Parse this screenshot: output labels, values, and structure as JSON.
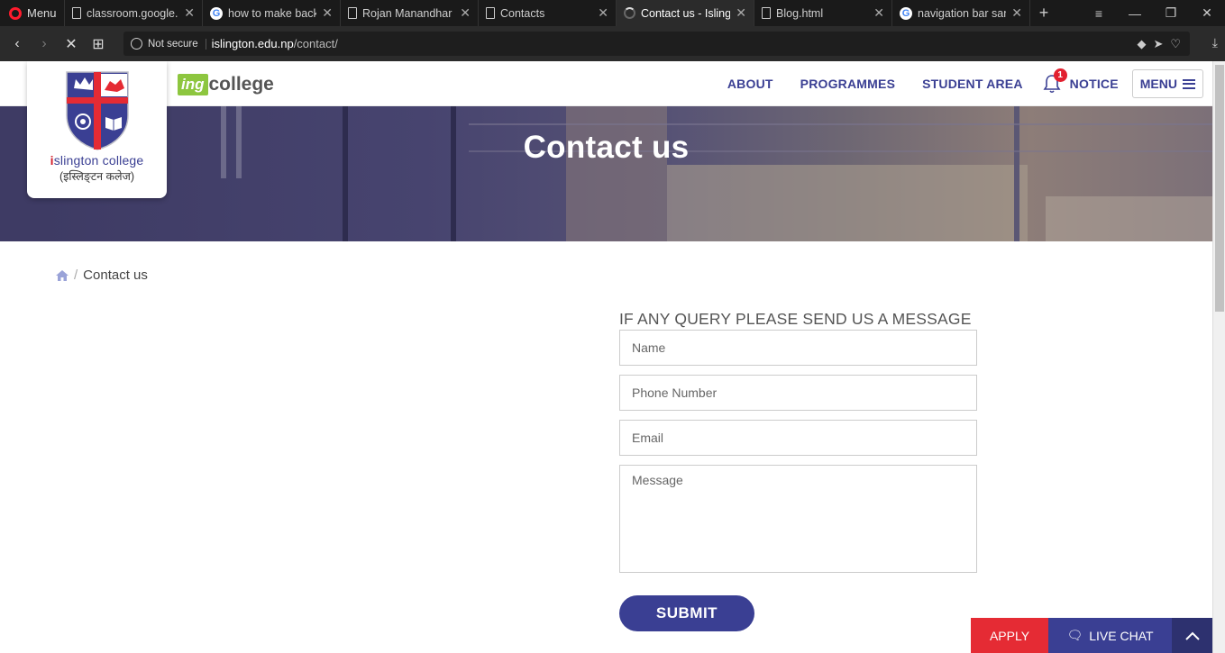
{
  "browser": {
    "menu_label": "Menu",
    "tabs": [
      {
        "title": "classroom.google.",
        "icon": "doc"
      },
      {
        "title": "how to make back",
        "icon": "google"
      },
      {
        "title": "Rojan Manandhar",
        "icon": "doc"
      },
      {
        "title": "Contacts",
        "icon": "doc"
      },
      {
        "title": "Contact us - Isling",
        "icon": "loading",
        "active": true
      },
      {
        "title": "Blog.html",
        "icon": "doc"
      },
      {
        "title": "navigation bar san",
        "icon": "google"
      }
    ],
    "security_label": "Not secure",
    "url_host": "islington.edu.np",
    "url_path": "/contact/"
  },
  "site": {
    "logo_name_i": "i",
    "logo_name_rest": "slington college",
    "logo_sub": "(इस्लिङ्टन कलेज)",
    "ing_label": "ing",
    "ing_college": "college",
    "nav": {
      "about": "ABOUT",
      "programmes": "PROGRAMMES",
      "student_area": "STUDENT AREA",
      "notice": "NOTICE",
      "notice_count": "1",
      "menu": "MENU"
    }
  },
  "hero": {
    "title": "Contact us"
  },
  "breadcrumb": {
    "current": "Contact us"
  },
  "form": {
    "title": "IF ANY QUERY PLEASE SEND US A MESSAGE",
    "name_placeholder": "Name",
    "phone_placeholder": "Phone Number",
    "email_placeholder": "Email",
    "message_placeholder": "Message",
    "submit_label": "SUBMIT"
  },
  "sticky": {
    "apply_label": "APPLY",
    "live_chat_label": "LIVE CHAT"
  },
  "colors": {
    "brand_blue": "#3a3f93",
    "brand_red": "#e52b34",
    "ing_green": "#8dc63f"
  }
}
